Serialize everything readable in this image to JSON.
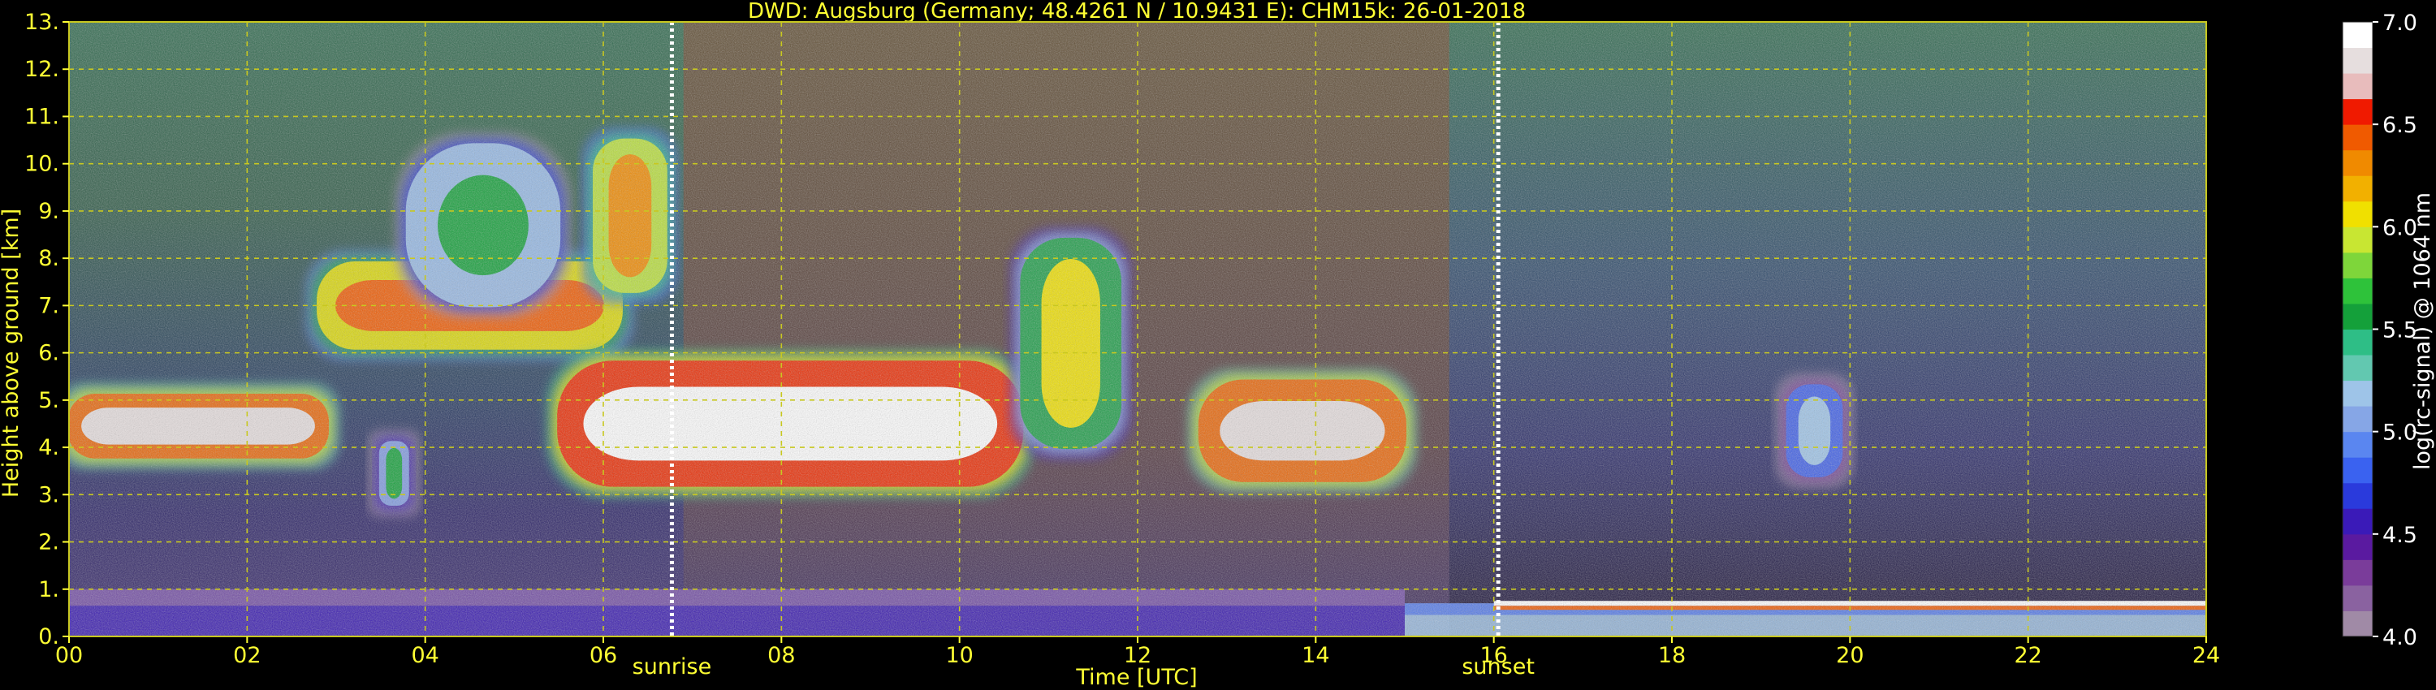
{
  "chart_data": {
    "type": "heatmap",
    "title": "DWD: Augsburg (Germany; 48.4261 N / 10.9431 E):    CHM15k: 26-01-2018",
    "xlabel": "Time [UTC]",
    "ylabel": "Height above ground [km]",
    "xlim": [
      0,
      24
    ],
    "ylim": [
      0,
      13
    ],
    "x_ticks": [
      0,
      2,
      4,
      6,
      8,
      10,
      12,
      14,
      16,
      18,
      20,
      22,
      24
    ],
    "x_tick_labels": [
      "00",
      "02",
      "04",
      "06",
      "08",
      "10",
      "12",
      "14",
      "16",
      "18",
      "20",
      "22",
      "24"
    ],
    "y_ticks": [
      0,
      1,
      2,
      3,
      4,
      5,
      6,
      7,
      8,
      9,
      10,
      11,
      12,
      13
    ],
    "y_tick_labels": [
      "0.",
      "1.",
      "2.",
      "3.",
      "4.",
      "5.",
      "6.",
      "7.",
      "8.",
      "9.",
      "10.",
      "11.",
      "12.",
      "13."
    ],
    "grid": true,
    "colorbar": {
      "label": "log(rc-signal) @ 1064 nm",
      "range": [
        4.0,
        7.0
      ],
      "ticks": [
        4.0,
        4.5,
        5.0,
        5.5,
        6.0,
        6.5,
        7.0
      ],
      "tick_labels": [
        "4.0",
        "4.5",
        "5.0",
        "5.5",
        "6.0",
        "6.5",
        "7.0"
      ],
      "colors": [
        "#a08aa6",
        "#8a62a0",
        "#7a3c9a",
        "#5a1aa0",
        "#3a1ab8",
        "#2a3adc",
        "#3a62f0",
        "#5a86f0",
        "#86a6e6",
        "#9ec4e8",
        "#62c8b0",
        "#2ebe86",
        "#14a03a",
        "#2ec23a",
        "#7ed63a",
        "#c8e632",
        "#f0e000",
        "#f2b000",
        "#f08a00",
        "#f05a00",
        "#f01a00",
        "#e8bcbc",
        "#e6dede",
        "#ffffff"
      ]
    },
    "vertical_markers": [
      {
        "x": 6.77,
        "label": "sunrise"
      },
      {
        "x": 16.05,
        "label": "sunset"
      }
    ],
    "cloud_layers": [
      {
        "x_start": 0.0,
        "x_end": 2.9,
        "y_bottom": 3.8,
        "y_top": 5.1,
        "intensity": 6.8
      },
      {
        "x_start": 2.8,
        "x_end": 6.2,
        "y_bottom": 6.1,
        "y_top": 7.9,
        "intensity": 6.4
      },
      {
        "x_start": 3.8,
        "x_end": 5.5,
        "y_bottom": 7.0,
        "y_top": 10.4,
        "intensity": 5.6
      },
      {
        "x_start": 5.9,
        "x_end": 6.7,
        "y_bottom": 7.3,
        "y_top": 10.5,
        "intensity": 6.3
      },
      {
        "x_start": 5.5,
        "x_end": 10.7,
        "y_bottom": 3.2,
        "y_top": 5.8,
        "intensity": 6.9
      },
      {
        "x_start": 10.7,
        "x_end": 11.8,
        "y_bottom": 4.0,
        "y_top": 8.4,
        "intensity": 6.0
      },
      {
        "x_start": 12.7,
        "x_end": 15.0,
        "y_bottom": 3.3,
        "y_top": 5.4,
        "intensity": 6.8
      },
      {
        "x_start": 3.5,
        "x_end": 3.8,
        "y_bottom": 2.8,
        "y_top": 4.1,
        "intensity": 5.5
      },
      {
        "x_start": 19.3,
        "x_end": 19.9,
        "y_bottom": 3.4,
        "y_top": 5.3,
        "intensity": 5.2
      }
    ],
    "boundary_layers": [
      {
        "x_start": 0.0,
        "x_end": 15.0,
        "y_bottom": 0.0,
        "y_top": 1.0,
        "intensity": 4.6
      },
      {
        "x_start": 15.0,
        "x_end": 24.0,
        "y_bottom": 0.0,
        "y_top": 0.7,
        "intensity": 5.2
      }
    ]
  }
}
